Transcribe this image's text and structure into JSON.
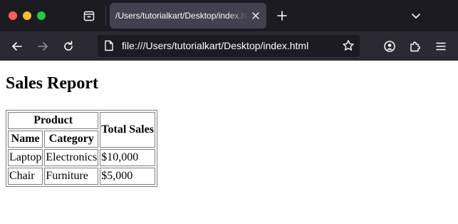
{
  "browser": {
    "tab": {
      "title": "/Users/tutorialkart/Desktop/index.html"
    },
    "url": "file:///Users/tutorialkart/Desktop/index.html",
    "icons": {
      "tab_manager": "tab-manager-icon",
      "tab_close": "close-icon",
      "new_tab": "plus-icon",
      "tab_list": "chevron-down-icon",
      "back": "arrow-left-icon",
      "forward": "arrow-right-icon",
      "reload": "reload-icon",
      "page": "page-icon",
      "bookmark": "star-icon",
      "account": "account-icon",
      "extensions": "puzzle-icon",
      "menu": "hamburger-icon"
    },
    "colors": {
      "tabstrip_bg": "#1c1b22",
      "toolbar_bg": "#2b2a33",
      "active_tab_bg": "#42414d",
      "close_button": "#ff5f57",
      "minimize_button": "#febc2e",
      "zoom_button": "#28c840"
    }
  },
  "page": {
    "heading": "Sales Report",
    "table": {
      "group_header": "Product",
      "total_header": "Total Sales",
      "sub_headers": [
        "Name",
        "Category"
      ],
      "rows": [
        {
          "name": "Laptop",
          "category": "Electronics",
          "total": "$10,000"
        },
        {
          "name": "Chair",
          "category": "Furniture",
          "total": "$5,000"
        }
      ]
    }
  }
}
